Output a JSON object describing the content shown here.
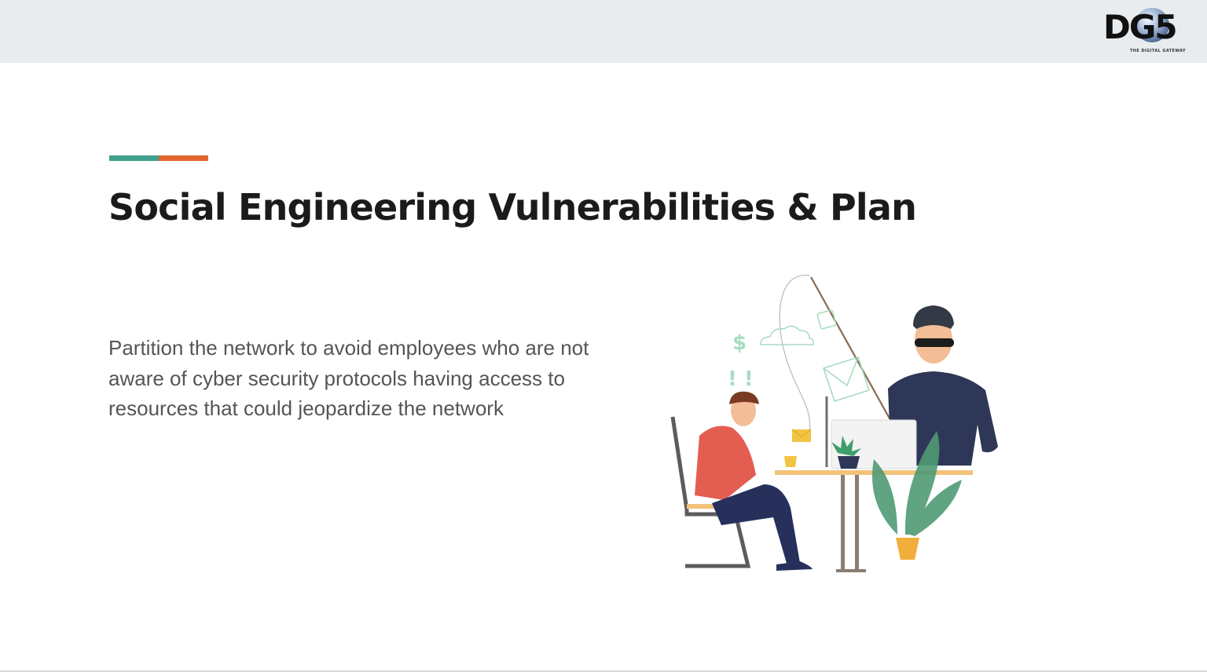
{
  "header": {
    "logo_text": "DG5",
    "logo_tagline": "THE DIGITAL GATEWAY"
  },
  "colors": {
    "accent_teal": "#3f9f8c",
    "accent_orange": "#e0652d",
    "header_band": "#e8ecee"
  },
  "slide": {
    "title": "Social Engineering Vulnerabilities & Plan",
    "body": "Partition the network to avoid employees who are not aware of cyber security protocols having access to resources that could jeopardize the network"
  },
  "illustration": {
    "icons": [
      "dollar-icon",
      "cloud-icon",
      "envelope-icon",
      "exclamation-icon",
      "fishing-hook-icon",
      "plant-icon",
      "laptop-icon",
      "coffee-cup-icon"
    ]
  }
}
